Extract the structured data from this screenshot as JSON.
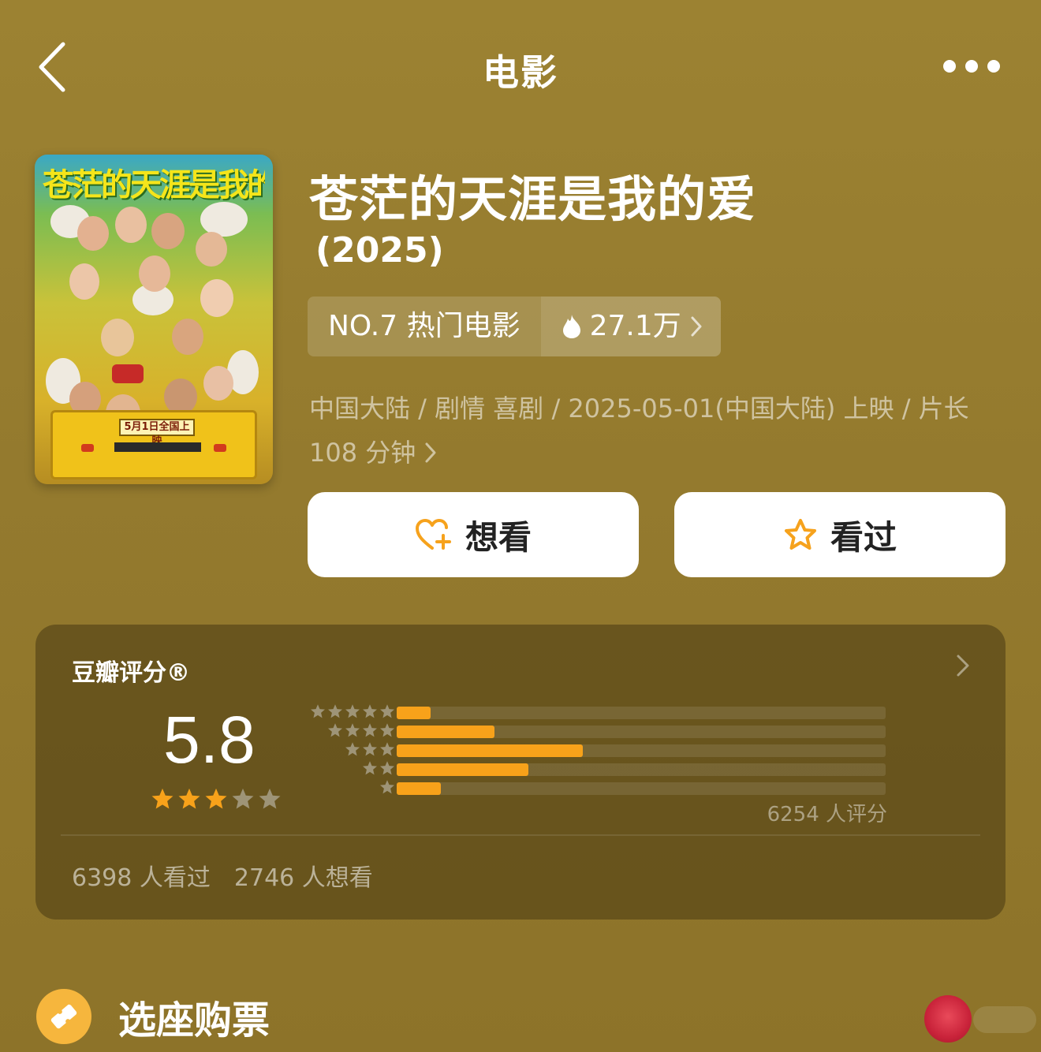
{
  "nav": {
    "title": "电影"
  },
  "poster": {
    "title_text": "苍茫的天涯是我的爱",
    "release_banner": "5月1日全国上映"
  },
  "movie": {
    "title": "苍茫的天涯是我的爱",
    "year": "(2025)",
    "rank": "NO.7 热门电影",
    "heat": "27.1万",
    "meta_line1": "中国大陆 / 剧情 喜剧 / 2025-05-01(中国大陆) 上映 / 片长",
    "meta_line2": "108 分钟"
  },
  "actions": {
    "want_label": "想看",
    "seen_label": "看过"
  },
  "rating": {
    "title": "豆瓣评分®",
    "score": "5.8",
    "stars": 3,
    "distribution": [
      {
        "stars": 5,
        "fraction": 0.07
      },
      {
        "stars": 4,
        "fraction": 0.2
      },
      {
        "stars": 3,
        "fraction": 0.38
      },
      {
        "stars": 2,
        "fraction": 0.27
      },
      {
        "stars": 1,
        "fraction": 0.09
      }
    ],
    "rating_count": "6254 人评分",
    "watched": "6398 人看过",
    "want": "2746 人想看"
  },
  "ticket": {
    "label": "选座购票"
  },
  "colors": {
    "background": "#9c8232",
    "accent": "#f8a21a",
    "star_empty": "#9e9477"
  }
}
